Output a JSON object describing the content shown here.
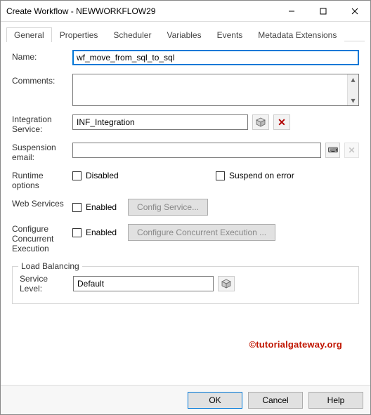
{
  "window": {
    "title": "Create Workflow - NEWWORKFLOW29"
  },
  "tabs": [
    "General",
    "Properties",
    "Scheduler",
    "Variables",
    "Events",
    "Metadata Extensions"
  ],
  "labels": {
    "name": "Name:",
    "comments": "Comments:",
    "integration_service": "Integration Service:",
    "suspension_email": "Suspension email:",
    "runtime_options": "Runtime options",
    "web_services": "Web Services",
    "configure_concurrent": "Configure Concurrent Execution",
    "load_balancing": "Load Balancing",
    "service_level": "Service Level:"
  },
  "fields": {
    "name_value": "wf_move_from_sql_to_sql",
    "comments_value": "",
    "integration_service_value": "INF_Integration",
    "suspension_email_value": "",
    "service_level_value": "Default"
  },
  "checkboxes": {
    "disabled": "Disabled",
    "suspend_on_error": "Suspend on error",
    "ws_enabled": "Enabled",
    "cc_enabled": "Enabled"
  },
  "buttons": {
    "config_service": "Config Service...",
    "configure_concurrent_execution": "Configure Concurrent Execution ...",
    "ok": "OK",
    "cancel": "Cancel",
    "help": "Help"
  },
  "watermark": "©tutorialgateway.org"
}
